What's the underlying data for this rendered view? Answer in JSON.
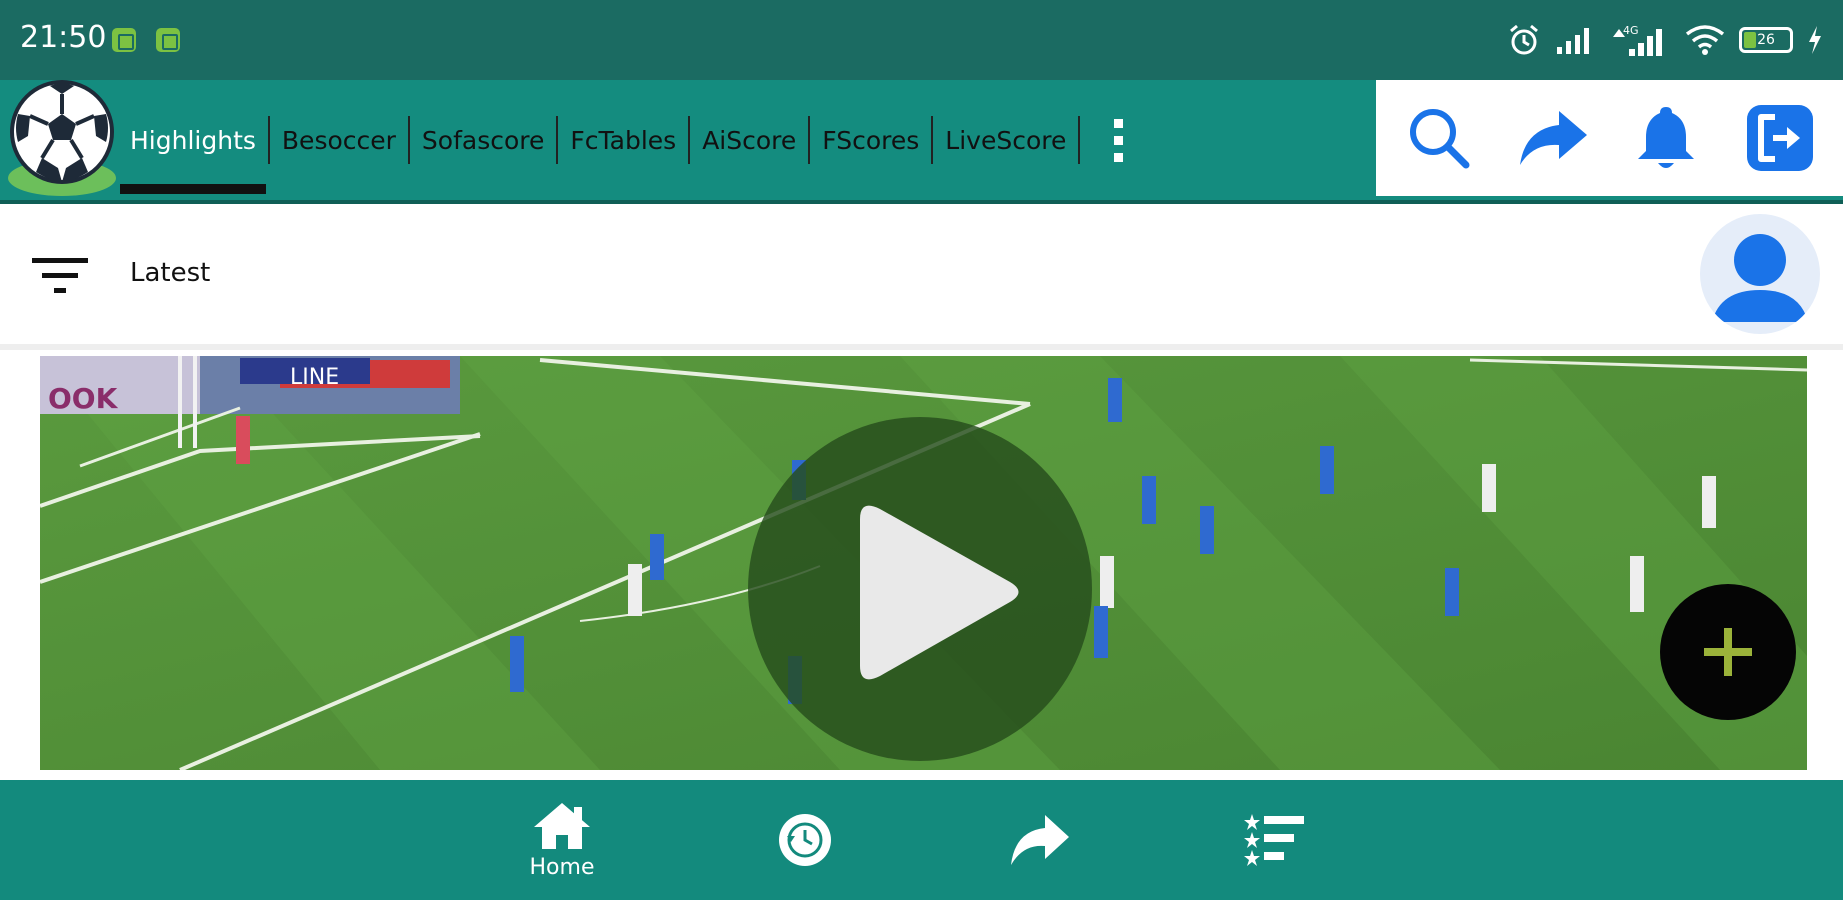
{
  "status_bar": {
    "time": "21:50",
    "battery_level": "26",
    "network_label": "4G"
  },
  "app_bar": {
    "tabs": [
      {
        "label": "Highlights",
        "active": true
      },
      {
        "label": "Besoccer",
        "active": false
      },
      {
        "label": "Sofascore",
        "active": false
      },
      {
        "label": "FcTables",
        "active": false
      },
      {
        "label": "AiScore",
        "active": false
      },
      {
        "label": "FScores",
        "active": false
      },
      {
        "label": "LiveScore",
        "active": false
      }
    ],
    "more_icon": "more-vertical-icon",
    "actions": [
      "search-icon",
      "share-icon",
      "bell-icon",
      "exit-icon"
    ]
  },
  "sub_header": {
    "filter_icon": "filter-icon",
    "label": "Latest",
    "avatar_icon": "user-avatar-icon"
  },
  "video": {
    "play_icon": "play-icon",
    "fab_icon": "plus-icon",
    "overlay_text": "LINE"
  },
  "bottom_nav": {
    "items": [
      {
        "icon": "home-icon",
        "label": "Home"
      },
      {
        "icon": "history-icon",
        "label": ""
      },
      {
        "icon": "share-icon",
        "label": ""
      },
      {
        "icon": "ranking-list-icon",
        "label": ""
      }
    ]
  },
  "colors": {
    "status_bar": "#1b6b62",
    "app_bar": "#148c7f",
    "accent_blue": "#1a73e8",
    "pitch_green": "#4f8a35",
    "bottom_nav": "#138a7d",
    "fab": "#050505",
    "fab_plus": "#9bb33a"
  }
}
